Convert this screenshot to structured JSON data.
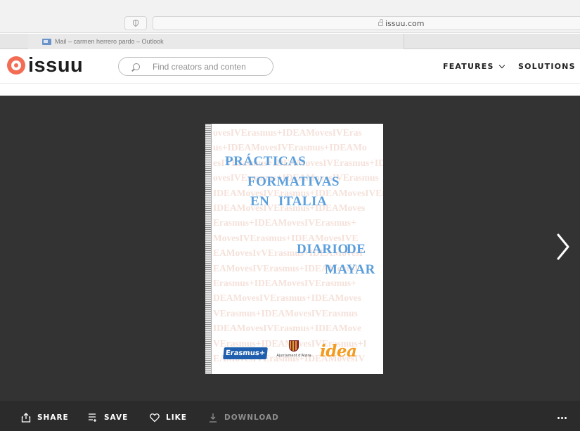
{
  "browser": {
    "url": "issuu.com",
    "tab_title": "Mail – carmen herrero pardo – Outlook"
  },
  "header": {
    "logo_text": "issuu",
    "search_placeholder": "Find creators and conten",
    "nav": [
      {
        "label": "FEATURES"
      },
      {
        "label": "SOLUTIONS"
      }
    ]
  },
  "document": {
    "pattern_lines": [
      "ovesIVErasmus+IDEAMovesIVEras",
      "us+IDEAMovesIVErasmus+IDEAMo",
      "esIVErasmus+IDEAMovesIVErasmus+IDEA",
      "ovesIVErasmus+IDEAMovesIVErasmus",
      "IDEAMovesIVErasmus+IDEAMovesIVErasmus",
      "IDEAMovesIVErasmus+IDEAMoves",
      "Erasmus+IDEAMovesIVErasmus+",
      "MovesIVErasmus+IDEAMovesIVE",
      "EAMovesIvVErasmus+IDEAMovesI",
      "EAMovesIVErasmus+IDEAMovesI",
      "Erasmus+IDEAMovesIVErasmus+",
      "DEAMovesIVErasmus+IDEAMoves",
      "VErasmus+IDEAMovesIVErasmus",
      "IDEAMovesIVErasmus+IDEAMove",
      "VErasmus+IDEAMovesIVErasmus+I",
      "EAMovesIVErasmus+IDEAMovesIV"
    ],
    "title_lines": [
      "PRÁCTICAS",
      "FORMATIVAS",
      "EN",
      "ITALIA",
      "DIARIO",
      "DE",
      "MAYAR"
    ],
    "logos": {
      "erasmus": "Erasmus+",
      "ajuntament": "Ajuntament d'Alzira",
      "idea": "idea"
    }
  },
  "toolbar": {
    "share": "SHARE",
    "save": "SAVE",
    "like": "LIKE",
    "download": "DOWNLOAD"
  }
}
